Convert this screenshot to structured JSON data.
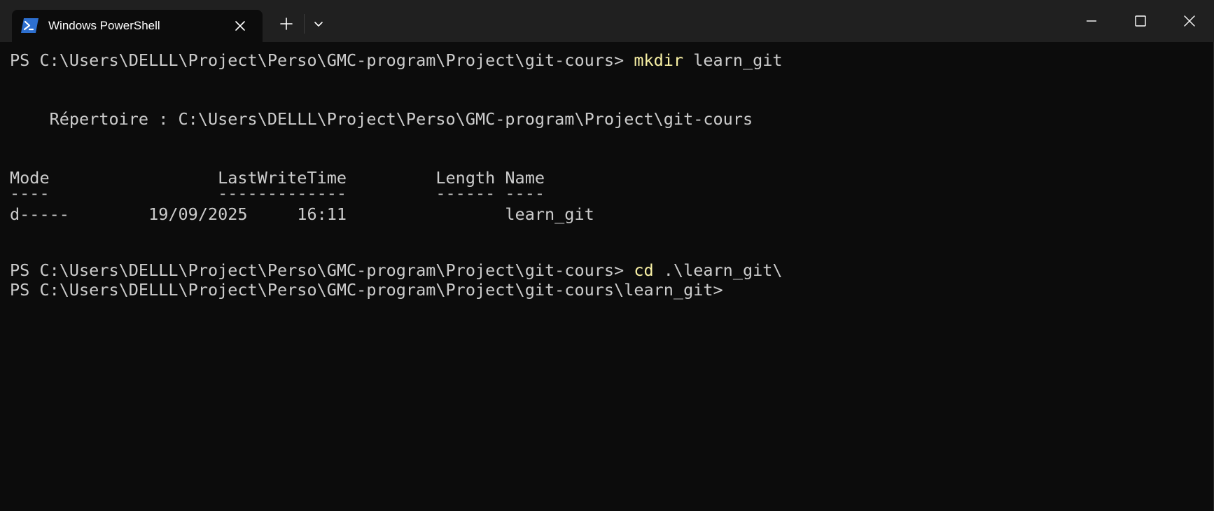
{
  "window": {
    "tab_title": "Windows PowerShell"
  },
  "terminal": {
    "lines": {
      "l1_prompt": "PS C:\\Users\\DELLL\\Project\\Perso\\GMC-program\\Project\\git-cours> ",
      "l1_cmd": "mkdir",
      "l1_arg": " learn_git",
      "l2": "    Répertoire : C:\\Users\\DELLL\\Project\\Perso\\GMC-program\\Project\\git-cours",
      "l3_header": "Mode                 LastWriteTime         Length Name",
      "l4_underline": "----                 -------------         ------ ----",
      "l5_row": "d-----        19/09/2025     16:11                learn_git",
      "l6_prompt": "PS C:\\Users\\DELLL\\Project\\Perso\\GMC-program\\Project\\git-cours> ",
      "l6_cmd": "cd",
      "l6_arg": " .\\learn_git\\",
      "l7_prompt": "PS C:\\Users\\DELLL\\Project\\Perso\\GMC-program\\Project\\git-cours\\learn_git>"
    }
  },
  "colors": {
    "background": "#0c0c0c",
    "titlebar": "#202020",
    "text": "#cccccc",
    "command": "#f9f1a5",
    "powershell_icon": "#2d6fcf"
  },
  "icons": {
    "tab_icon": "powershell-icon",
    "tab_close": "close-icon",
    "new_tab": "plus-icon",
    "dropdown": "chevron-down-icon",
    "minimize": "minimize-icon",
    "maximize": "maximize-icon",
    "close": "close-icon"
  }
}
